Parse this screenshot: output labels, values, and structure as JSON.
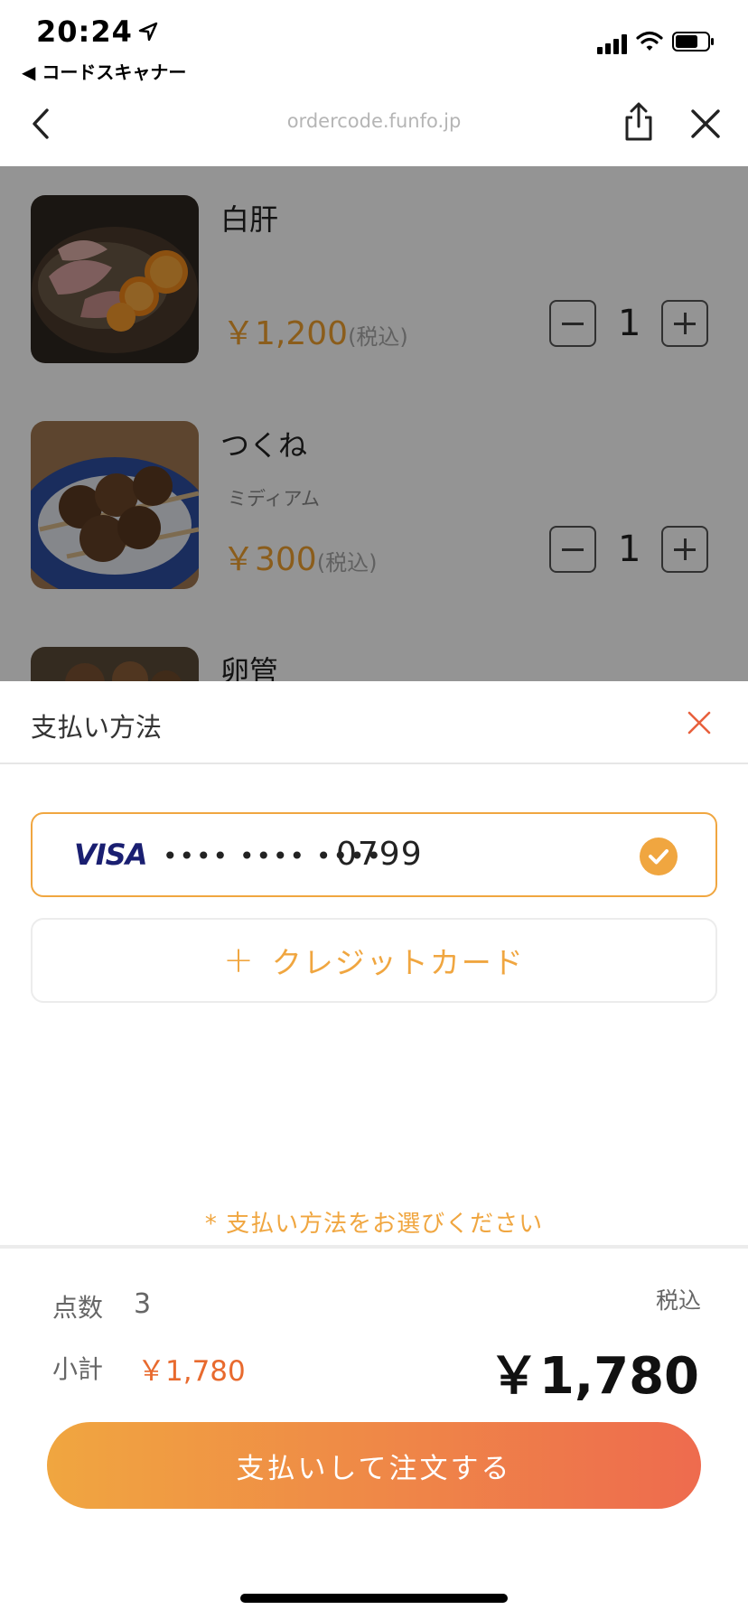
{
  "status_bar": {
    "time": "20:24",
    "back_app": "◀ コードスキャナー"
  },
  "browser": {
    "url": "ordercode.funfo.jp"
  },
  "order_items": [
    {
      "name": "白肝",
      "option": "",
      "price": "￥1,200",
      "tax_note": "(税込)",
      "quantity": "1"
    },
    {
      "name": "つくね",
      "option": "ミディアム",
      "price": "￥300",
      "tax_note": "(税込)",
      "quantity": "1"
    },
    {
      "name": "卵管",
      "option": "",
      "price": "",
      "tax_note": "",
      "quantity": ""
    }
  ],
  "payment": {
    "title": "支払い方法",
    "card": {
      "brand": "VISA",
      "masked": "•••• •••• ••••",
      "last4": "0799",
      "selected": true
    },
    "add_card_plus": "+",
    "add_card_label": "クレジットカード",
    "note": "* 支払い方法をお選びください"
  },
  "summary": {
    "count_label": "点数",
    "count_value": "3",
    "tax_label": "税込",
    "subtotal_label": "小計",
    "subtotal_value": "￥1,780",
    "total_value": "￥1,780",
    "pay_button_label": "支払いして注文する"
  },
  "colors": {
    "accent": "#f0a640",
    "accent_end": "#ee6b4e",
    "price_orange": "#f0a030",
    "subtotal_red": "#e86a2e",
    "close_red": "#e8603c",
    "visa_blue": "#1a1f71"
  }
}
